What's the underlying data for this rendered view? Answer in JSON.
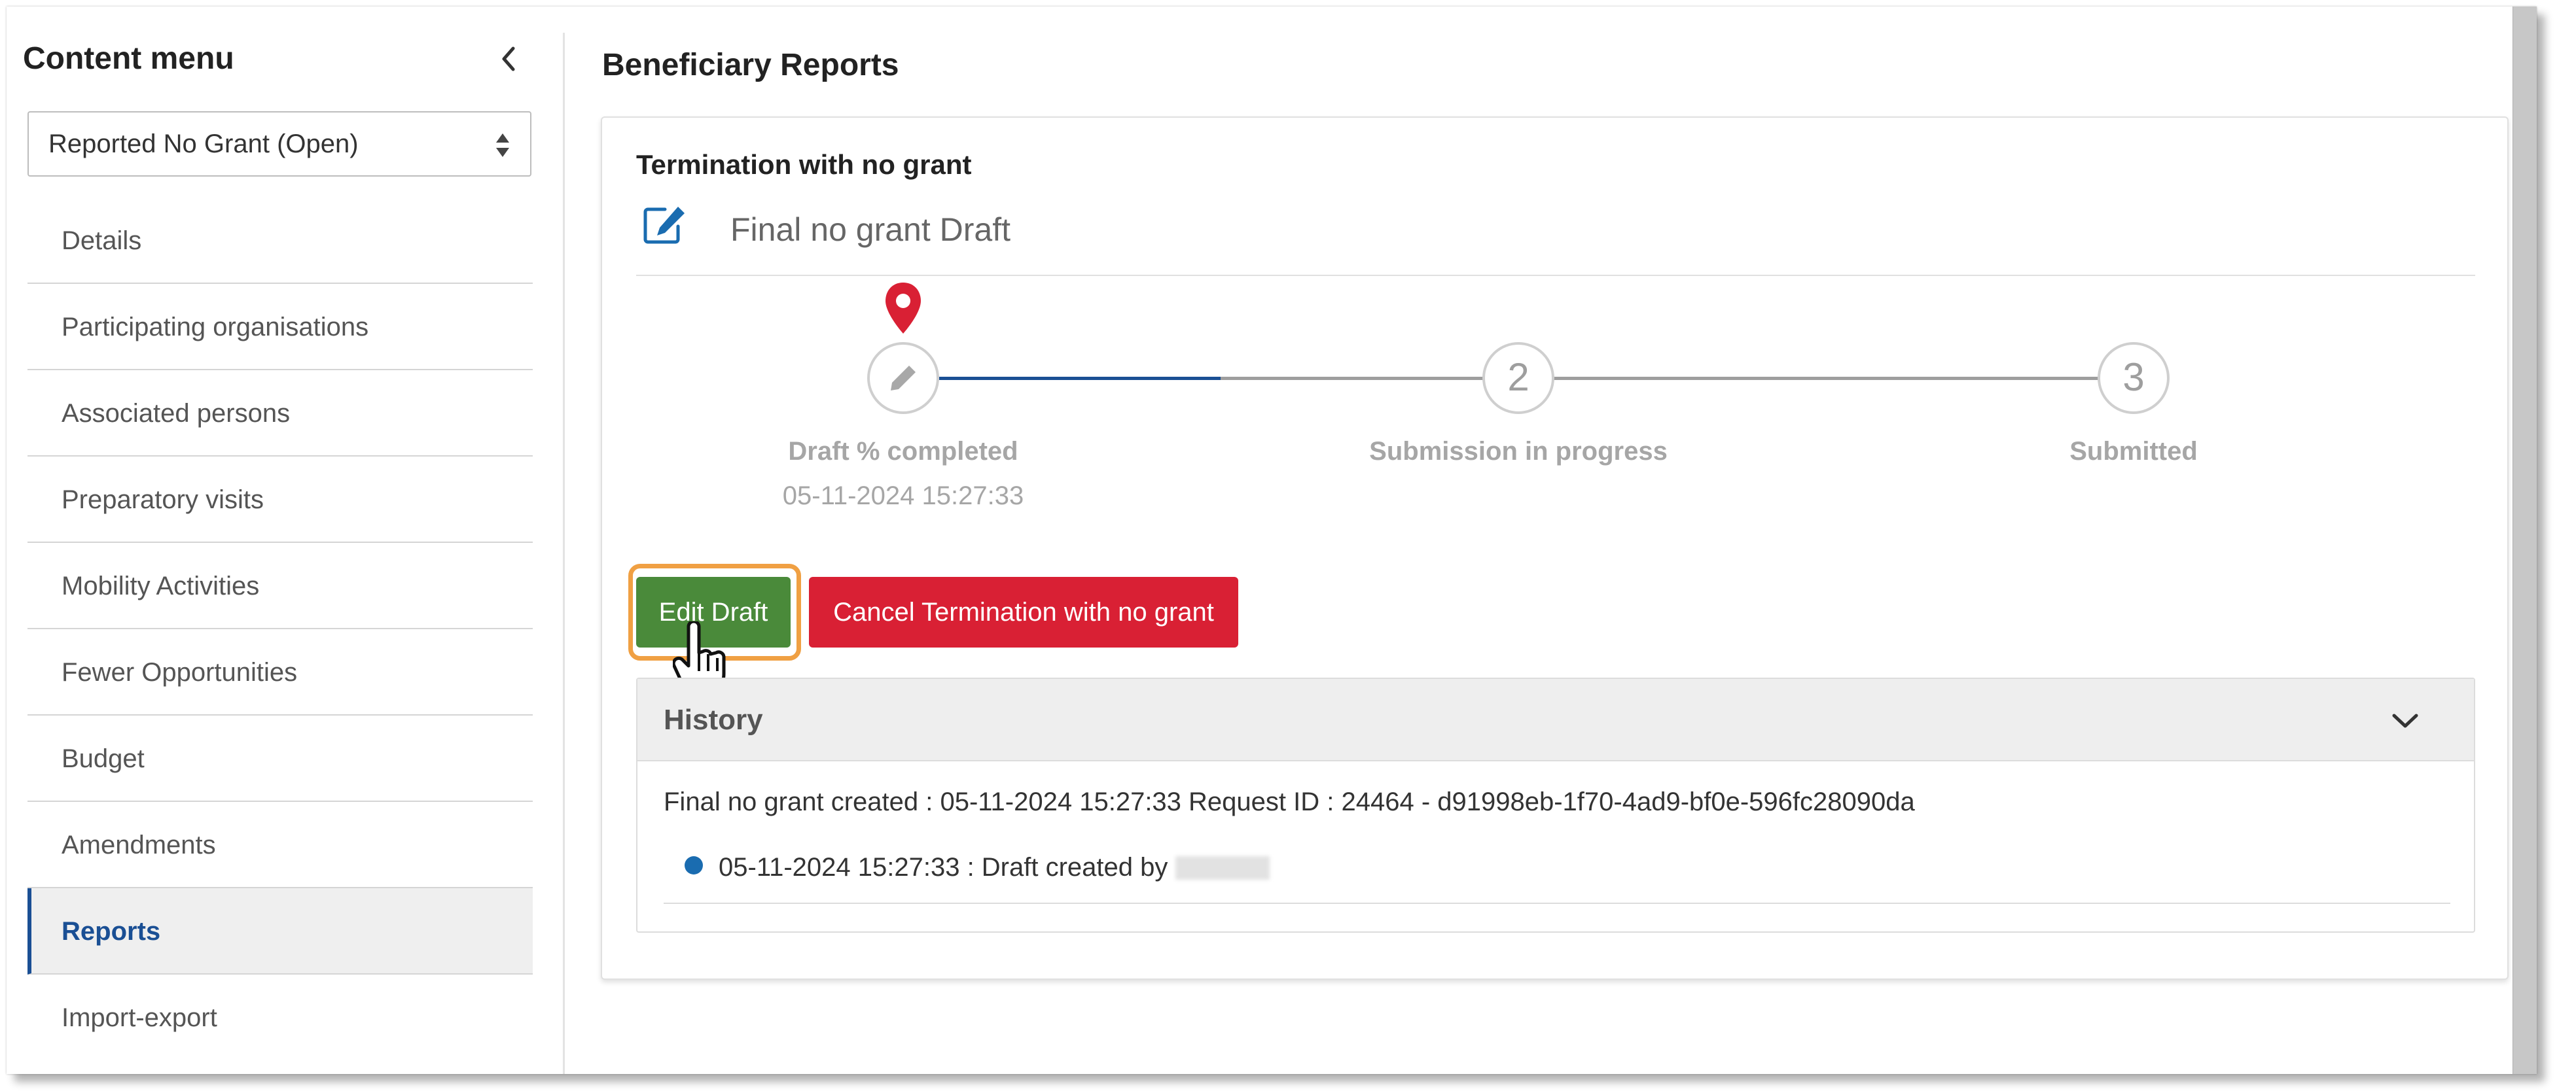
{
  "sidebar": {
    "title": "Content menu",
    "select_value": "Reported No Grant (Open)",
    "items": [
      {
        "label": "Details"
      },
      {
        "label": "Participating organisations"
      },
      {
        "label": "Associated persons"
      },
      {
        "label": "Preparatory visits"
      },
      {
        "label": "Mobility Activities"
      },
      {
        "label": "Fewer Opportunities"
      },
      {
        "label": "Budget"
      },
      {
        "label": "Amendments"
      },
      {
        "label": "Reports",
        "active": true
      },
      {
        "label": "Import-export"
      }
    ]
  },
  "main": {
    "page_title": "Beneficiary Reports",
    "card": {
      "heading": "Termination with no grant",
      "status": "Final no grant Draft",
      "steps": [
        {
          "label": "Draft % completed",
          "date": "05-11-2024 15:27:33",
          "icon": "pencil-icon",
          "current": true
        },
        {
          "number": "2",
          "label": "Submission in progress"
        },
        {
          "number": "3",
          "label": "Submitted"
        }
      ],
      "buttons": {
        "edit": "Edit Draft",
        "cancel": "Cancel Termination with no grant"
      },
      "history": {
        "title": "History",
        "summary": "Final no grant created : 05-11-2024 15:27:33 Request ID : 24464 - d91998eb-1f70-4ad9-bf0e-596fc28090da",
        "entries": [
          {
            "text": "05-11-2024 15:27:33 : Draft created by"
          }
        ]
      }
    }
  },
  "colors": {
    "accent_blue": "#1a4f94",
    "edit_green": "#4a8a3a",
    "cancel_red": "#d92034",
    "highlight_orange": "#f0a043",
    "pin_red": "#d92034"
  }
}
